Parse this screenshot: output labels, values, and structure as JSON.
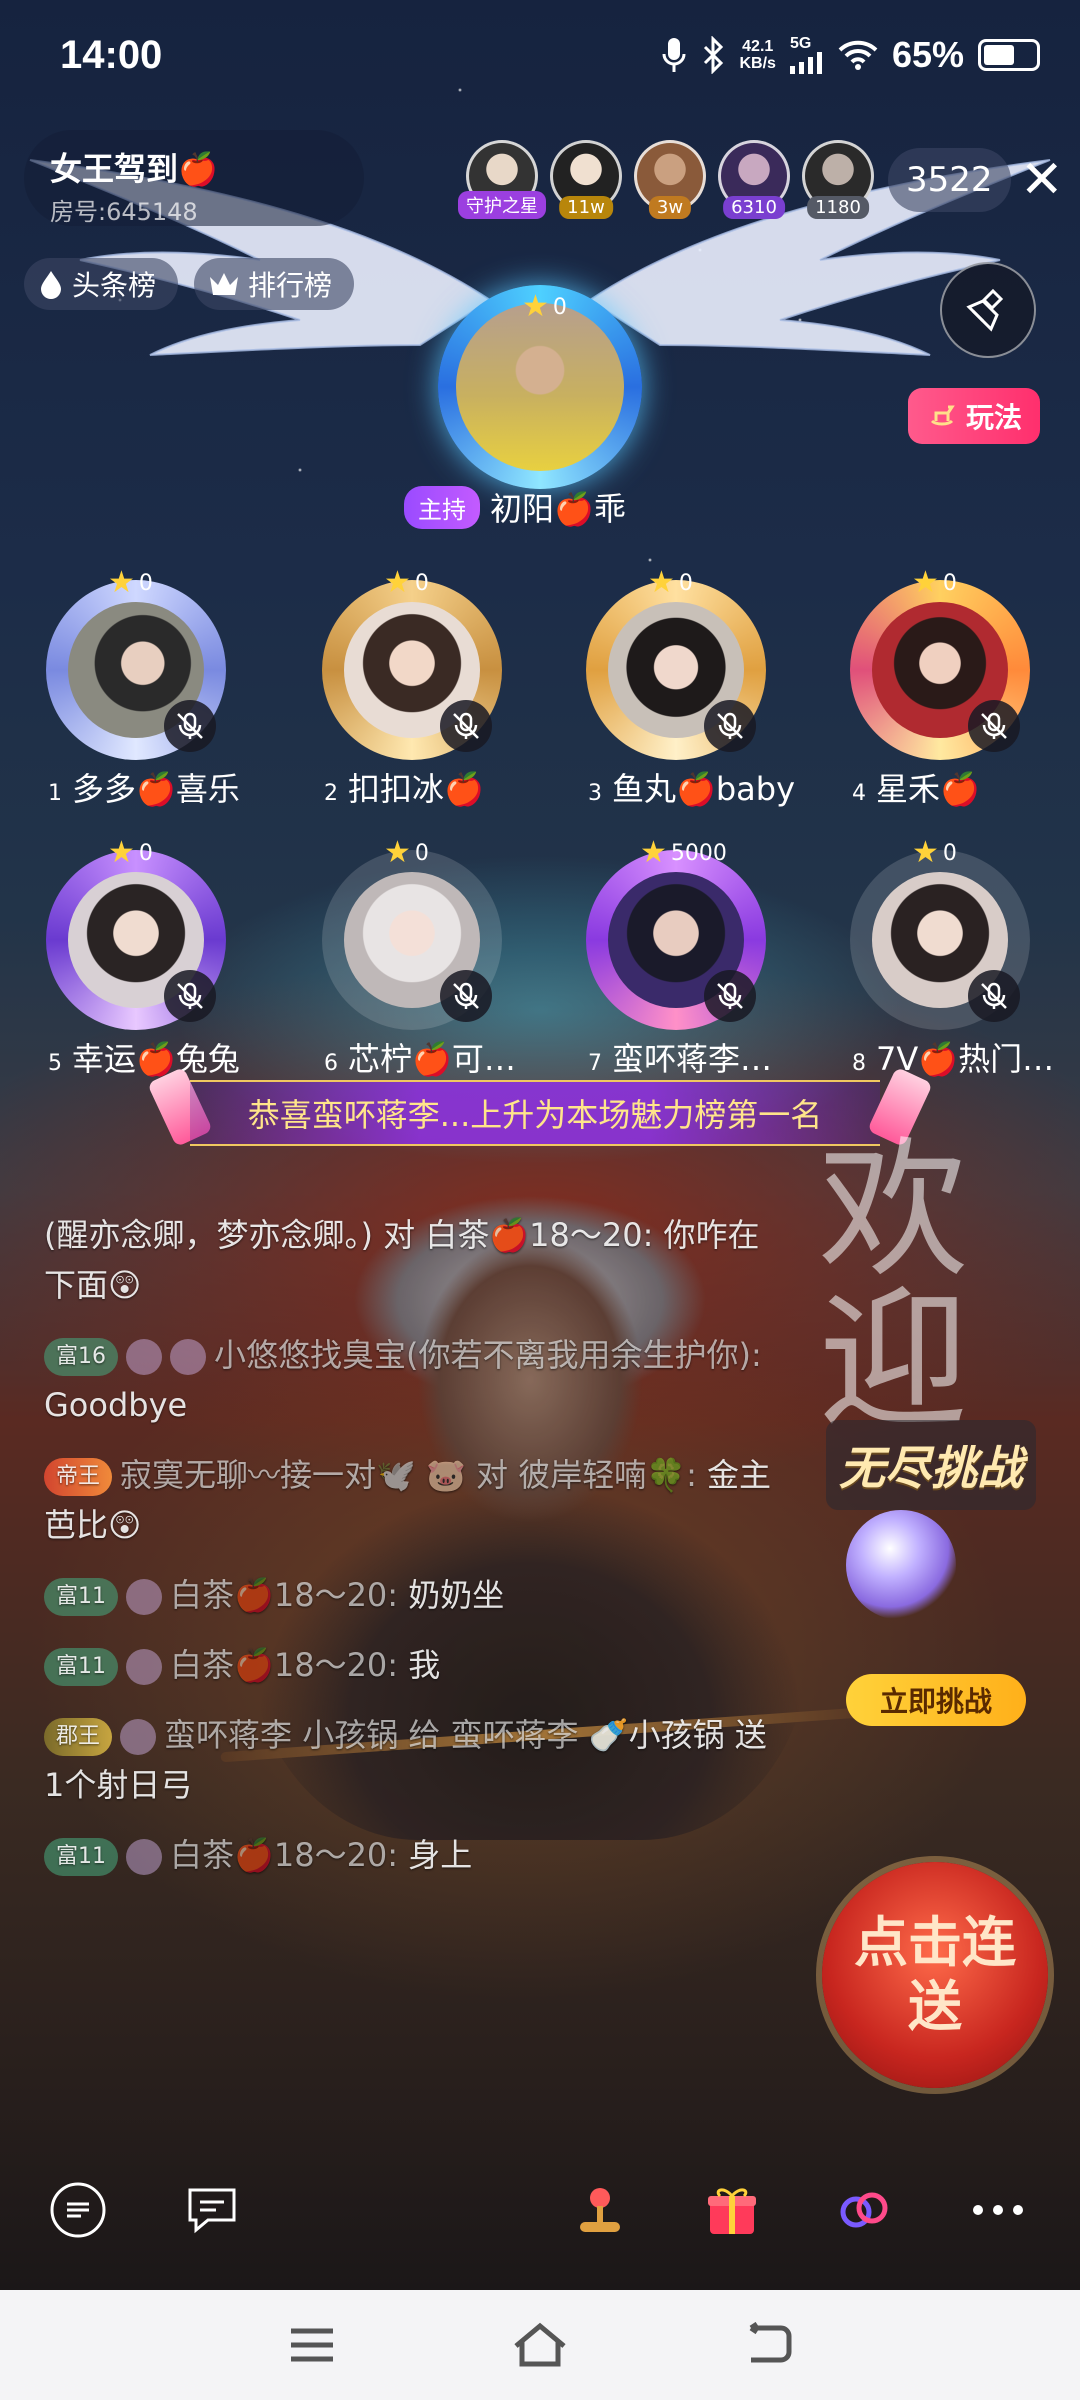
{
  "status_bar": {
    "time": "14:00",
    "net_speed_value": "42.1",
    "net_speed_unit": "KB/s",
    "cell_label": "5G",
    "battery": "65%",
    "battery_level": 0.65
  },
  "room": {
    "title": "女王驾到🍎",
    "room_id": "房号:645148"
  },
  "pills": {
    "headline": "头条榜",
    "ranking": "排行榜"
  },
  "viewers": [
    {
      "badge": "守护之星",
      "color": "#9b3fe0"
    },
    {
      "badge": "11w",
      "color": "#b8860b"
    },
    {
      "badge": "3w",
      "color": "#c07a20"
    },
    {
      "badge": "6310",
      "color": "#7a3fd0"
    },
    {
      "badge": "1180",
      "color": "#555a66"
    }
  ],
  "viewer_count": "3522",
  "play_button": "玩法",
  "host": {
    "tag": "主持",
    "name": "初阳🍎乖",
    "score": "0"
  },
  "seats": [
    {
      "num": "1",
      "name": "多多🍎喜乐",
      "score": "0"
    },
    {
      "num": "2",
      "name": "扣扣冰🍎",
      "score": "0"
    },
    {
      "num": "3",
      "name": "鱼丸🍎baby",
      "score": "0"
    },
    {
      "num": "4",
      "name": "星禾🍎",
      "score": "0"
    },
    {
      "num": "5",
      "name": "幸运🍎兔兔",
      "score": "0"
    },
    {
      "num": "6",
      "name": "芯柠🍎可…",
      "score": "0"
    },
    {
      "num": "7",
      "name": "蛮吥蒋李…",
      "score": "5000"
    },
    {
      "num": "8",
      "name": "7V🍎热门…",
      "score": "0"
    }
  ],
  "announcement": "恭喜蛮吥蒋李...上升为本场魅力榜第一名",
  "chat": [
    {
      "text": "(醒亦念卿，梦亦念卿。) 对 白茶🍎18～20: 你咋在下面😲"
    },
    {
      "level": "富16",
      "who": "小悠悠找臭宝(你若不离我用余生护你):",
      "text": " Goodbye"
    },
    {
      "level": "帝王",
      "who": "寂寞无聊〰接一对🕊️ 🐷 对 彼岸轻喃🍀:",
      "text": " 金主芭比😲"
    },
    {
      "level": "富11",
      "who": "白茶🍎18～20:",
      "text": " 奶奶坐"
    },
    {
      "level": "富11",
      "who": "白茶🍎18～20:",
      "text": " 我"
    },
    {
      "level": "郡王",
      "who": "蛮吥蒋李 小孩锅 给 蛮吥蒋李",
      "text": " 🍼小孩锅 送1个射日弓"
    },
    {
      "level": "富11",
      "who": "白茶🍎18～20:",
      "text": " 身上"
    }
  ],
  "promo": {
    "welcome": "欢迎",
    "challenge": "无尽挑战",
    "challenge_button": "立即挑战",
    "combo": "点击连送"
  },
  "colors": {
    "accent_pink": "#ff2f6d",
    "announce_text": "#ffe58a",
    "star_gold": "#ffd23a"
  }
}
